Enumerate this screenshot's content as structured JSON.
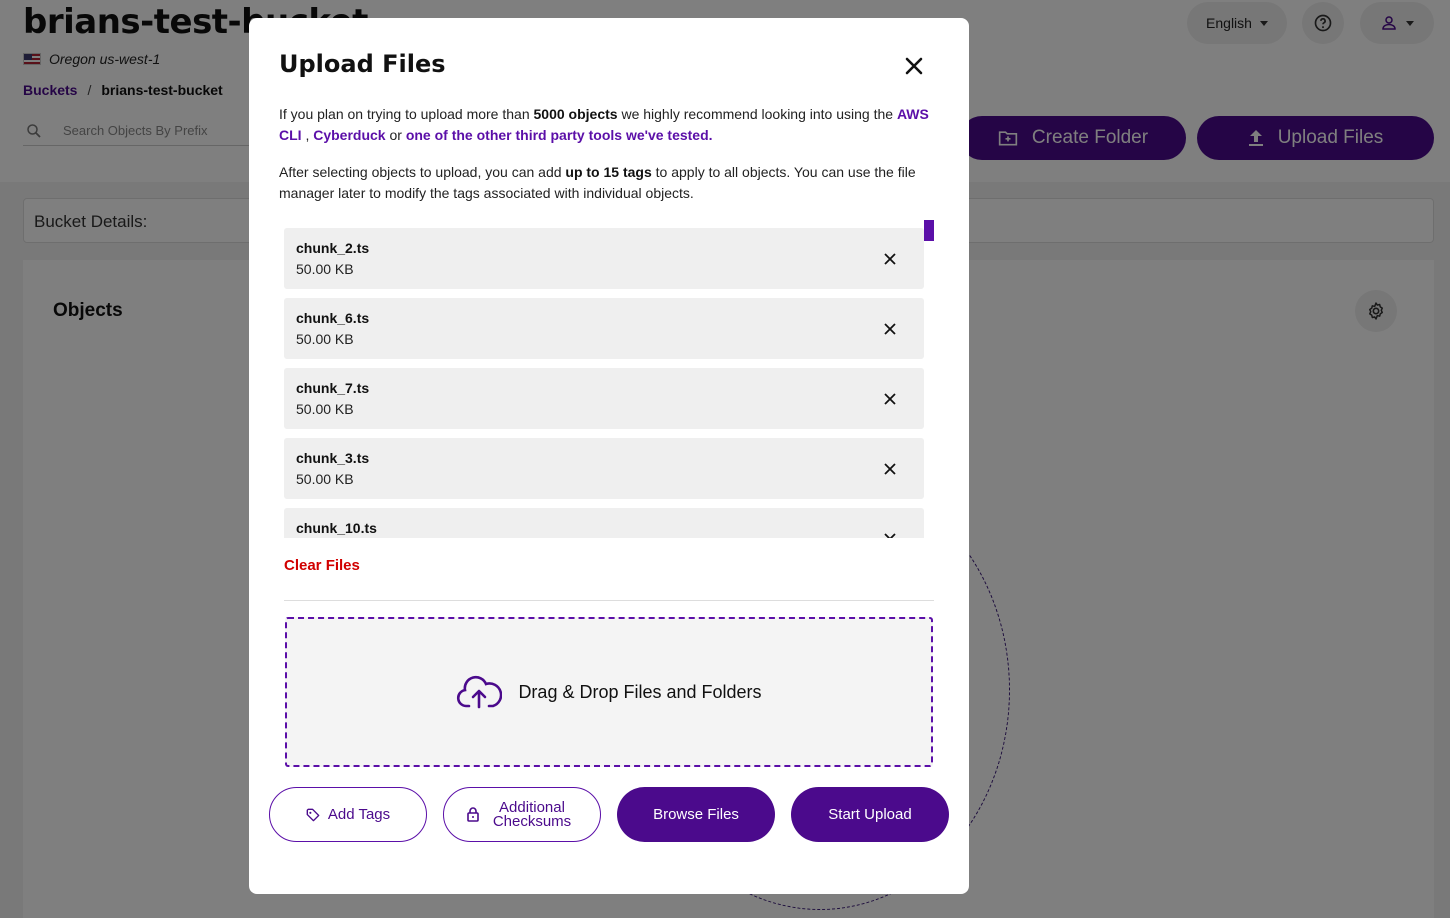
{
  "background": {
    "bucket_title": "brians-test-bucket",
    "region": "Oregon us-west-1",
    "breadcrumb": {
      "root": "Buckets",
      "separator": "/",
      "current": "brians-test-bucket"
    },
    "search": {
      "placeholder": "Search Objects By Prefix"
    },
    "language": "English",
    "buttons": {
      "create_folder": "Create Folder",
      "upload_files": "Upload Files"
    },
    "bucket_details": "Bucket Details:",
    "objects_title": "Objects"
  },
  "modal": {
    "title": "Upload Files",
    "info1": {
      "t1": "If you plan on trying to upload more than ",
      "count": "5000 objects",
      "t2": " we highly recommend looking into using the ",
      "link_aws": "AWS CLI",
      "t3": " , ",
      "link_cyberduck": "Cyberduck",
      "t4": " or ",
      "link_other": "one of the other third party tools we've tested."
    },
    "info2": {
      "t1": "After selecting objects to upload, you can add ",
      "tags": "up to 15 tags",
      "t2": " to apply to all objects. You can use the file manager later to modify the tags associated with individual objects."
    },
    "files": [
      {
        "name": "chunk_2.ts",
        "size": "50.00 KB"
      },
      {
        "name": "chunk_6.ts",
        "size": "50.00 KB"
      },
      {
        "name": "chunk_7.ts",
        "size": "50.00 KB"
      },
      {
        "name": "chunk_3.ts",
        "size": "50.00 KB"
      },
      {
        "name": "chunk_10.ts",
        "size": ""
      }
    ],
    "clear_files": "Clear Files",
    "dropzone_label": "Drag & Drop Files and Folders",
    "buttons": {
      "add_tags": "Add Tags",
      "additional_checksums": "Additional\nChecksums",
      "browse_files": "Browse Files",
      "start_upload": "Start Upload"
    }
  },
  "colors": {
    "accent": "#4b0a8c",
    "link": "#5b0fa8",
    "danger": "#d10000"
  }
}
